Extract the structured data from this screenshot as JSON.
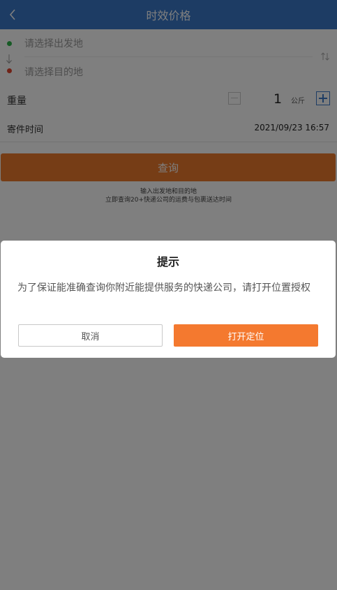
{
  "header": {
    "title": "时效价格",
    "back_icon": "chevron-left-icon"
  },
  "locations": {
    "origin_placeholder": "请选择出发地",
    "destination_placeholder": "请选择目的地",
    "origin_dot_color": "#2db44a",
    "destination_dot_color": "#e0452e",
    "swap_icon": "swap-icon"
  },
  "weight": {
    "label": "重量",
    "value": "1",
    "unit": "公斤"
  },
  "send_time": {
    "label": "寄件时间",
    "value": "2021/09/23 16:57"
  },
  "query_button": {
    "label": "查询",
    "color": "#ed7a2d"
  },
  "hints": {
    "line1": "输入出发地和目的地",
    "line2": "立即查询20+快递公司的运费与包裹送达时间"
  },
  "dialog": {
    "title": "提示",
    "message": "为了保证能准确查询你附近能提供服务的快递公司，请打开位置授权",
    "cancel_label": "取消",
    "confirm_label": "打开定位",
    "confirm_color": "#f4792f"
  },
  "theme": {
    "primary": "#3a78c8"
  }
}
